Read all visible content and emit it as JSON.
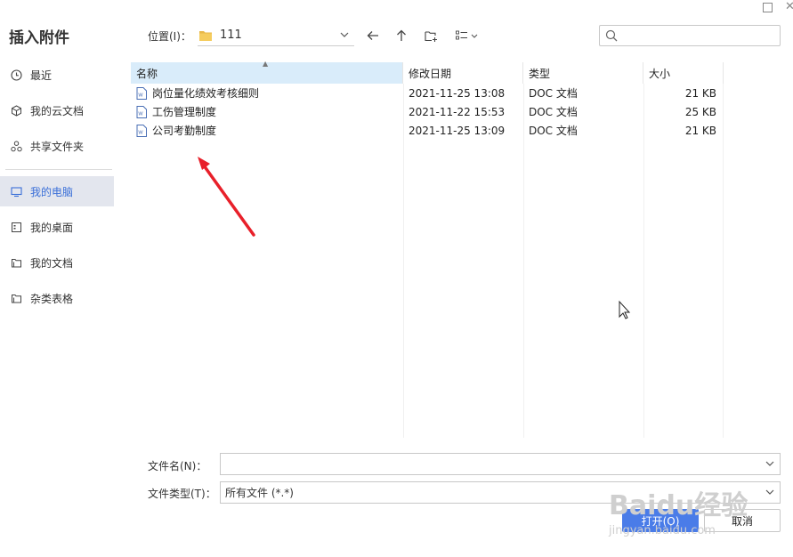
{
  "dialog": {
    "title": "插入附件"
  },
  "sidebar": {
    "items": [
      {
        "label": "最近",
        "icon": "clock-icon"
      },
      {
        "label": "我的云文档",
        "icon": "cube-icon"
      },
      {
        "label": "共享文件夹",
        "icon": "share-icon"
      },
      {
        "label": "我的电脑",
        "icon": "monitor-icon",
        "active": true
      },
      {
        "label": "我的桌面",
        "icon": "desktop-icon"
      },
      {
        "label": "我的文档",
        "icon": "folder-icon"
      },
      {
        "label": "杂类表格",
        "icon": "folder-icon"
      }
    ]
  },
  "toolbar": {
    "location_label": "位置(I)：",
    "location_value": "111",
    "search_placeholder": ""
  },
  "list": {
    "columns": [
      "名称",
      "修改日期",
      "类型",
      "大小"
    ],
    "rows": [
      {
        "name": "岗位量化绩效考核细则",
        "date": "2021-11-25 13:08",
        "type": "DOC 文档",
        "size": "21 KB"
      },
      {
        "name": "工伤管理制度",
        "date": "2021-11-22 15:53",
        "type": "DOC 文档",
        "size": "25 KB"
      },
      {
        "name": "公司考勤制度",
        "date": "2021-11-25 13:09",
        "type": "DOC 文档",
        "size": "21 KB"
      }
    ]
  },
  "footer": {
    "filename_label": "文件名(N)：",
    "filename_value": "",
    "filetype_label": "文件类型(T)：",
    "filetype_value": "所有文件 (*.*)",
    "open_label": "打开(O)",
    "cancel_label": "取消"
  },
  "watermark": {
    "text": "Baidu经验",
    "subtext": "jingyan.baidu.com"
  },
  "colors": {
    "accent": "#4a7ce8",
    "active_bg": "#e3e6ee",
    "header_sorted": "#d9ecfa",
    "arrow": "#e8202a"
  }
}
